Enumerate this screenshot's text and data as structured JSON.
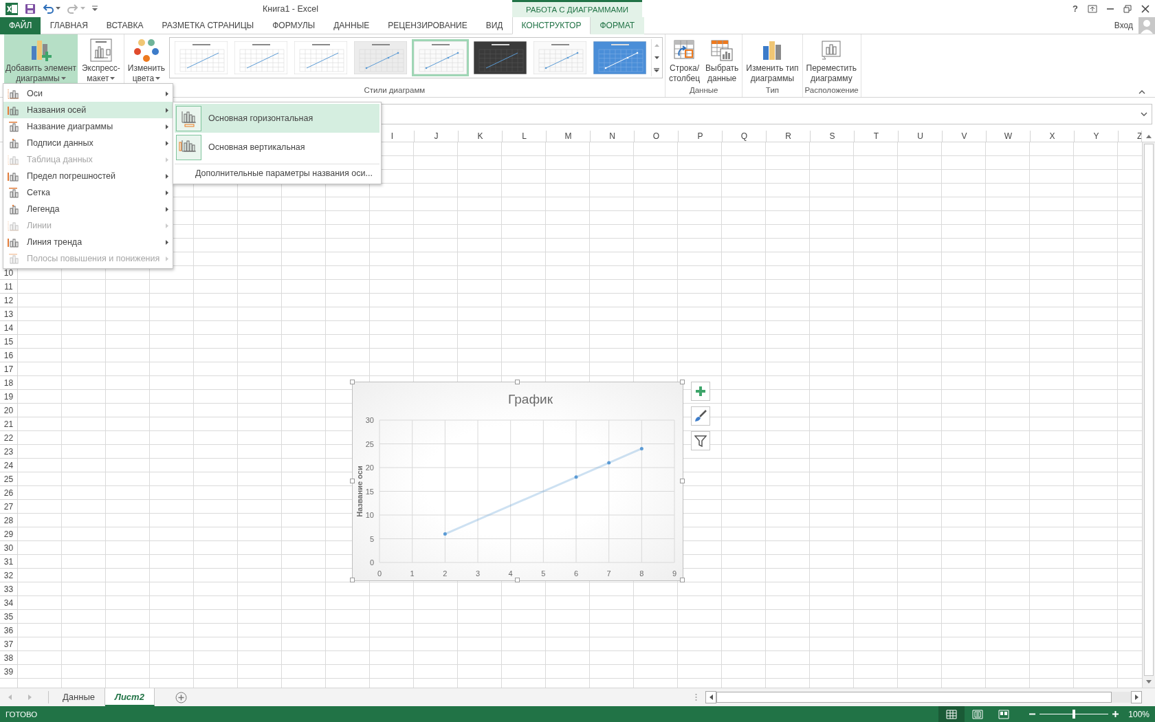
{
  "title_bar": {
    "title": "Книга1 - Excel",
    "context_header": "РАБОТА С ДИАГРАММАМИ",
    "help": "?",
    "account": "Вход"
  },
  "quick_access": [
    {
      "kind": "save",
      "disabled": false
    },
    {
      "kind": "undo",
      "disabled": false
    },
    {
      "kind": "redo",
      "disabled": true
    }
  ],
  "tabs": [
    {
      "label": "ФАЙЛ",
      "kind": "file",
      "selected": false
    },
    {
      "label": "ГЛАВНАЯ",
      "kind": "main",
      "selected": false
    },
    {
      "label": "ВСТАВКА",
      "kind": "main",
      "selected": false
    },
    {
      "label": "РАЗМЕТКА СТРАНИЦЫ",
      "kind": "main",
      "selected": false
    },
    {
      "label": "ФОРМУЛЫ",
      "kind": "main",
      "selected": false
    },
    {
      "label": "ДАННЫЕ",
      "kind": "main",
      "selected": false
    },
    {
      "label": "РЕЦЕНЗИРОВАНИЕ",
      "kind": "main",
      "selected": false
    },
    {
      "label": "ВИД",
      "kind": "main",
      "selected": false
    },
    {
      "label": "КОНСТРУКТОР",
      "kind": "context",
      "selected": true
    },
    {
      "label": "ФОРМАТ",
      "kind": "context",
      "selected": false
    }
  ],
  "ribbon": {
    "groups": [
      {
        "buttons": [
          {
            "kind": "add-element",
            "lines": [
              "Добавить элемент",
              "диаграммы"
            ],
            "dropdown": true,
            "pressed": true
          },
          {
            "kind": "quick-layout",
            "lines": [
              "Экспресс-",
              "макет"
            ],
            "dropdown": true,
            "pressed": false
          }
        ]
      },
      {
        "label": "Стили диаграмм",
        "buttons": [
          {
            "kind": "colors",
            "lines": [
              "Изменить",
              "цвета"
            ],
            "dropdown": true,
            "pressed": false
          }
        ],
        "gallery": [
          {
            "kind": "plain",
            "selected": false
          },
          {
            "kind": "plain",
            "selected": false
          },
          {
            "kind": "plain",
            "selected": false
          },
          {
            "kind": "dotted",
            "selected": false
          },
          {
            "kind": "soft",
            "selected": true
          },
          {
            "kind": "dark",
            "selected": false
          },
          {
            "kind": "soft",
            "selected": false
          },
          {
            "kind": "blue",
            "selected": false
          }
        ]
      },
      {
        "label": "Данные",
        "buttons": [
          {
            "kind": "switch",
            "lines": [
              "Строка/",
              "столбец"
            ],
            "dropdown": false,
            "pressed": false
          },
          {
            "kind": "select-data",
            "lines": [
              "Выбрать",
              "данные"
            ],
            "dropdown": false,
            "pressed": false
          }
        ]
      },
      {
        "label": "Тип",
        "buttons": [
          {
            "kind": "change-type",
            "lines": [
              "Изменить тип",
              "диаграммы"
            ],
            "dropdown": false,
            "pressed": false
          }
        ]
      },
      {
        "label": "Расположение",
        "buttons": [
          {
            "kind": "move",
            "lines": [
              "Переместить",
              "диаграмму"
            ],
            "dropdown": false,
            "pressed": false
          }
        ]
      }
    ]
  },
  "columns": [
    "I",
    "J",
    "K",
    "L",
    "M",
    "N",
    "O",
    "P",
    "Q",
    "R",
    "S",
    "T",
    "U",
    "V",
    "W",
    "X",
    "Y",
    "Z"
  ],
  "rows": [
    "10",
    "11",
    "12",
    "13",
    "14",
    "15",
    "16",
    "17",
    "18",
    "19",
    "20",
    "21",
    "22",
    "23",
    "24",
    "25",
    "26",
    "27",
    "28",
    "29",
    "30",
    "31",
    "32",
    "33",
    "34",
    "35",
    "36",
    "37",
    "38",
    "39"
  ],
  "chart": {
    "chart_data": {
      "type": "line",
      "grid": true,
      "title": "График",
      "ylabel": "Название оси",
      "x": [
        2,
        6,
        7,
        8
      ],
      "series": [
        {
          "color": "#5b9bd5",
          "values": [
            6,
            18,
            21,
            24
          ]
        }
      ],
      "xlim": [
        0,
        9
      ],
      "ylim": [
        0,
        30
      ],
      "xticks": [
        0,
        1,
        2,
        3,
        4,
        5,
        6,
        7,
        8,
        9
      ],
      "yticks": [
        0,
        5,
        10,
        15,
        20,
        25,
        30
      ]
    }
  },
  "menu": {
    "items": [
      {
        "label": "Оси",
        "selected": false,
        "disabled": false
      },
      {
        "label": "Названия осей",
        "selected": true,
        "disabled": false
      },
      {
        "label": "Название диаграммы",
        "selected": false,
        "disabled": false
      },
      {
        "label": "Подписи данных",
        "selected": false,
        "disabled": false
      },
      {
        "label": "Таблица данных",
        "selected": false,
        "disabled": true
      },
      {
        "label": "Предел погрешностей",
        "selected": false,
        "disabled": false
      },
      {
        "label": "Сетка",
        "selected": false,
        "disabled": false
      },
      {
        "label": "Легенда",
        "selected": false,
        "disabled": false
      },
      {
        "label": "Линии",
        "selected": false,
        "disabled": true
      },
      {
        "label": "Линия тренда",
        "selected": false,
        "disabled": false
      },
      {
        "label": "Полосы повышения и понижения",
        "selected": false,
        "disabled": true
      }
    ]
  },
  "submenu": {
    "items": [
      {
        "label": "Основная горизонтальная",
        "kind": "horizontal",
        "selected": true
      },
      {
        "label": "Основная вертикальная",
        "kind": "vertical",
        "selected": false
      },
      {
        "label": "Дополнительные параметры названия оси...",
        "kind": "more",
        "selected": false
      }
    ]
  },
  "sheets": [
    {
      "label": "Данные",
      "selected": false
    },
    {
      "label": "Лист2",
      "selected": true
    }
  ],
  "status_bar": {
    "text": "ГОТОВО",
    "views": [
      {
        "kind": "normal",
        "selected": true
      },
      {
        "kind": "page-layout",
        "selected": false
      },
      {
        "kind": "page-break",
        "selected": false
      }
    ],
    "zoom": {
      "level": 0.5,
      "reading": "100%"
    }
  }
}
